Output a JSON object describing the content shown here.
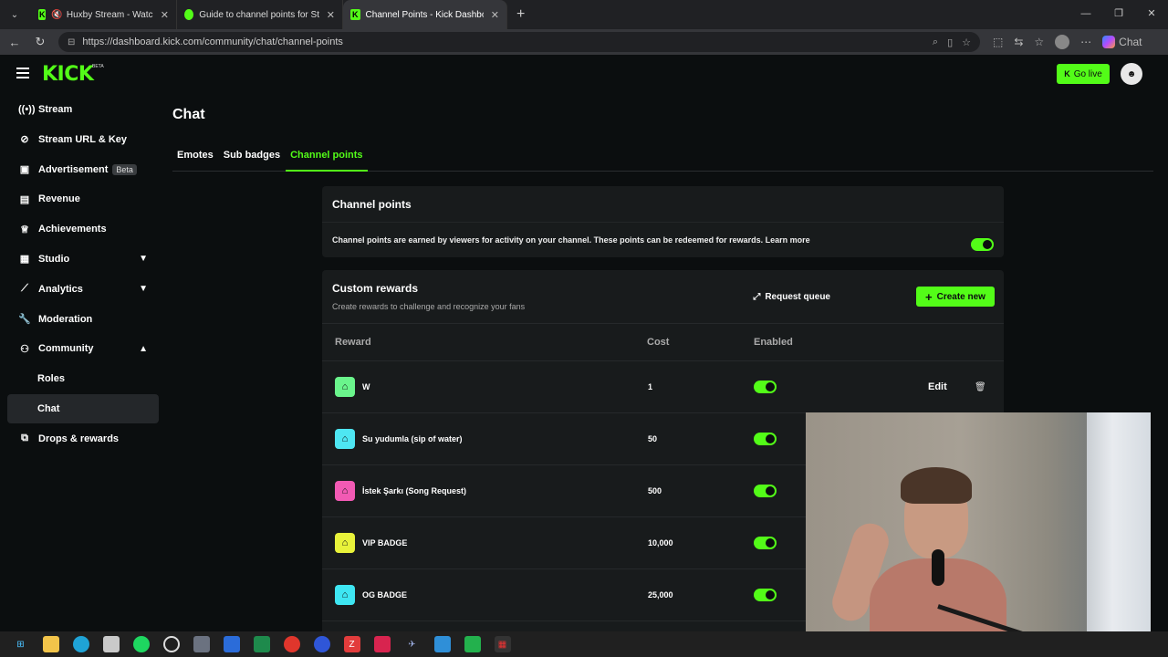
{
  "browser": {
    "tabs": [
      {
        "label": "Huxby Stream - Watch Live on",
        "favicon": "K",
        "color": "#53fc18",
        "muted": true
      },
      {
        "label": "Guide to channel points for Stream",
        "favicon": "⚙",
        "color": "#53fc18"
      },
      {
        "label": "Channel Points - Kick Dashboard",
        "favicon": "K",
        "color": "#53fc18",
        "active": true
      }
    ],
    "url": "https://dashboard.kick.com/community/chat/channel-points",
    "copilot_label": "Chat"
  },
  "header": {
    "logo": "KICK",
    "logo_sup": "BETA",
    "go_live_label": "Go live"
  },
  "sidebar": {
    "items": [
      {
        "label": "Stream",
        "icon": "broadcast-icon"
      },
      {
        "label": "Stream URL & Key",
        "icon": "link-icon"
      },
      {
        "label": "Advertisement",
        "icon": "ad-icon",
        "badge": "Beta"
      },
      {
        "label": "Revenue",
        "icon": "revenue-icon"
      },
      {
        "label": "Achievements",
        "icon": "trophy-icon"
      },
      {
        "label": "Studio",
        "icon": "studio-icon",
        "expandable": true
      },
      {
        "label": "Analytics",
        "icon": "analytics-icon",
        "expandable": true
      },
      {
        "label": "Moderation",
        "icon": "wrench-icon"
      },
      {
        "label": "Community",
        "icon": "community-icon",
        "expanded": true
      },
      {
        "label": "Roles",
        "sub": true
      },
      {
        "label": "Chat",
        "sub": true,
        "selected": true
      },
      {
        "label": "Drops & rewards",
        "icon": "gift-icon"
      }
    ]
  },
  "main": {
    "title": "Chat",
    "tabs": [
      "Emotes",
      "Sub badges",
      "Channel points"
    ],
    "active_tab": "Channel points",
    "channel_points": {
      "title": "Channel points",
      "description": "Channel points are earned by viewers for activity on your channel. These points can be redeemed for rewards. Learn more",
      "enabled": true
    },
    "custom_rewards": {
      "title": "Custom rewards",
      "subtitle": "Create rewards to challenge and recognize your fans",
      "request_queue_label": "Request queue",
      "create_label": "Create new",
      "columns": [
        "Reward",
        "Cost",
        "Enabled"
      ],
      "rows": [
        {
          "name": "W",
          "cost": "1",
          "enabled": true,
          "color": "#6af58c",
          "edit": "Edit"
        },
        {
          "name": "Su yudumla (sip of water)",
          "cost": "50",
          "enabled": true,
          "color": "#4ee6f2"
        },
        {
          "name": "İstek Şarkı (Song Request)",
          "cost": "500",
          "enabled": true,
          "color": "#f25ab4"
        },
        {
          "name": "VIP BADGE",
          "cost": "10,000",
          "enabled": true,
          "color": "#e8f23a"
        },
        {
          "name": "OG BADGE",
          "cost": "25,000",
          "enabled": true,
          "color": "#3ee6f2"
        }
      ]
    }
  },
  "colors": {
    "accent": "#53fc18",
    "background": "#0b0e0f",
    "card": "#181b1c"
  }
}
